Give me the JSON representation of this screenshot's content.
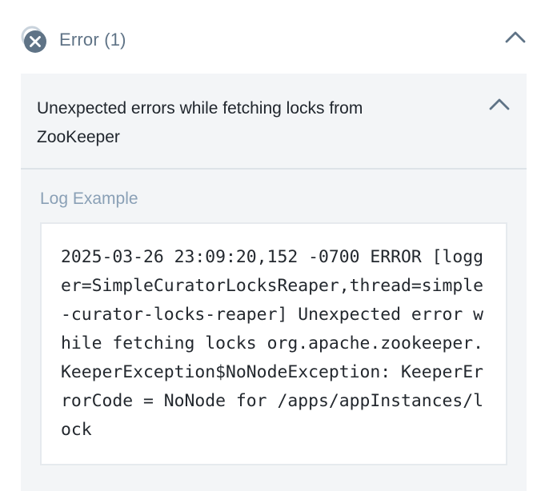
{
  "section": {
    "title": "Error (1)",
    "icon": "error-circle-icon",
    "chevron_icon": "chevron-up-icon",
    "accent_color": "#5f7386"
  },
  "error_card": {
    "title": "Unexpected errors while fetching locks from ZooKeeper",
    "chevron_icon": "chevron-up-icon",
    "log_label": "Log Example",
    "log_example": "2025-03-26 23:09:20,152 -0700 ERROR [logger=SimpleCuratorLocksReaper,thread=simple-curator-locks-reaper] Unexpected error while fetching locks org.apache.zookeeper.KeeperException$NoNodeException: KeeperErrorCode = NoNode for /apps/appInstances/lock"
  }
}
